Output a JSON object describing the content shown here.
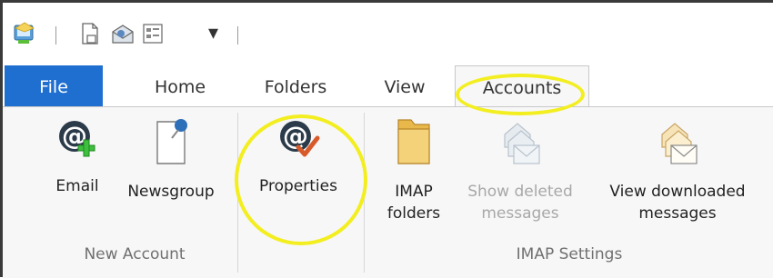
{
  "ribbon_tabs": [
    {
      "label": "File"
    },
    {
      "label": "Home"
    },
    {
      "label": "Folders"
    },
    {
      "label": "View"
    },
    {
      "label": "Accounts"
    }
  ],
  "groups": {
    "new_account": {
      "label": "New Account",
      "commands": {
        "email": {
          "label": "Email"
        },
        "newsgroup": {
          "label": "Newsgroup"
        }
      }
    },
    "properties": {
      "commands": {
        "properties": {
          "label": "Properties"
        }
      }
    },
    "imap_settings": {
      "label": "IMAP Settings",
      "commands": {
        "imap_folders": {
          "line1": "IMAP",
          "line2": "folders"
        },
        "show_deleted": {
          "line1": "Show deleted",
          "line2": "messages"
        },
        "view_downloaded": {
          "line1": "View downloaded",
          "line2": "messages"
        }
      }
    }
  },
  "colors": {
    "file_tab": "#1f6fd0",
    "highlight": "#f3ee1f",
    "ribbon_bg": "#f7f7f7"
  }
}
